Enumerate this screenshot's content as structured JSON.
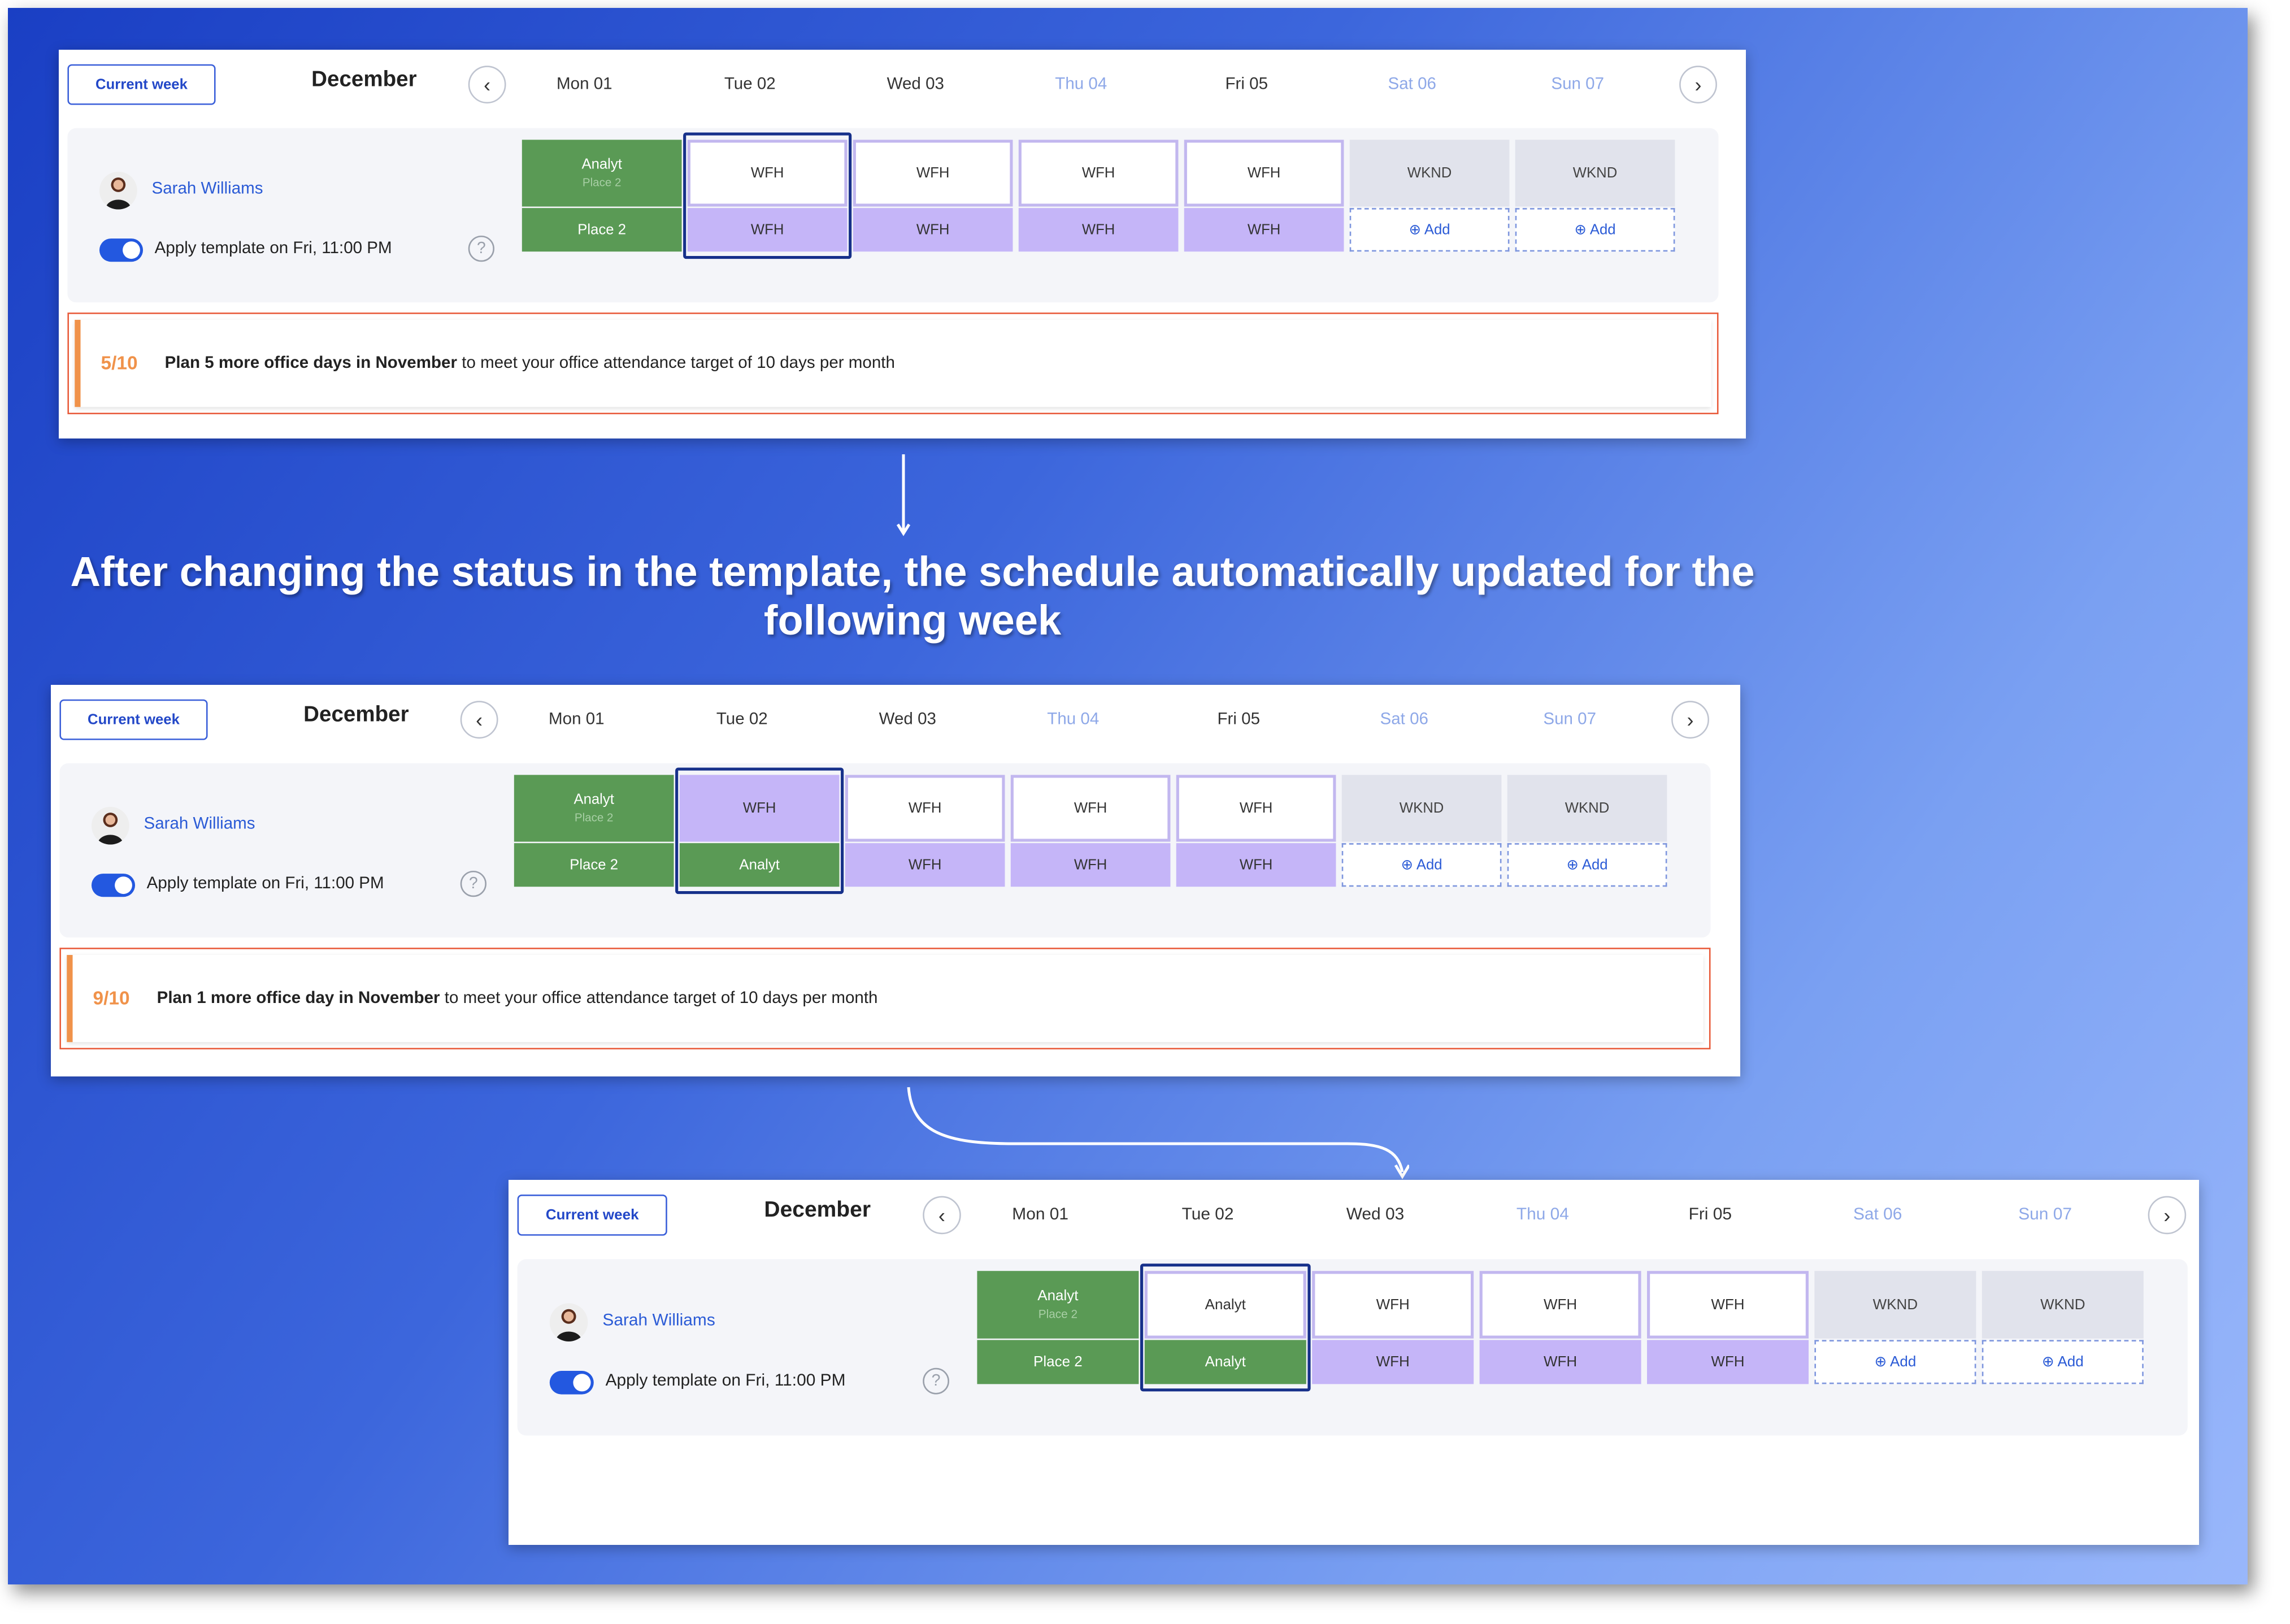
{
  "caption": "After changing the status in the template, the schedule automatically updated for the following week",
  "colors": {
    "office": "#5a9a55",
    "wfh": "#c5b5f8",
    "weekend": "#e1e3ec",
    "accent": "#2358e0",
    "alert_border": "#e85a3a",
    "alert_ratio": "#f0924a"
  },
  "panels": [
    {
      "toolbar": {
        "current_week": "Current week",
        "month": "December"
      },
      "days": [
        "Mon 01",
        "Tue 02",
        "Wed 03",
        "Thu 04",
        "Fri 05",
        "Sat 06",
        "Sun 07"
      ],
      "user": {
        "name": "Sarah Williams",
        "template_label": "Apply template on Fri, 11:00 PM",
        "help": "?"
      },
      "schedule_top": [
        {
          "label": "Analyt",
          "sub": "Place 2",
          "kind": "g"
        },
        {
          "label": "WFH",
          "sub": "",
          "kind": "w"
        },
        {
          "label": "WFH",
          "sub": "",
          "kind": "w"
        },
        {
          "label": "WFH",
          "sub": "",
          "kind": "w"
        },
        {
          "label": "WFH",
          "sub": "",
          "kind": "w"
        },
        {
          "label": "WKND",
          "sub": "",
          "kind": "k"
        },
        {
          "label": "WKND",
          "sub": "",
          "kind": "k"
        }
      ],
      "schedule_bottom": [
        {
          "label": "Place 2",
          "kind": "g"
        },
        {
          "label": "WFH",
          "kind": "p"
        },
        {
          "label": "WFH",
          "kind": "p"
        },
        {
          "label": "WFH",
          "kind": "p"
        },
        {
          "label": "WFH",
          "kind": "p"
        },
        {
          "label": "⊕ Add",
          "kind": "a"
        },
        {
          "label": "⊕ Add",
          "kind": "a"
        }
      ],
      "alert": {
        "ratio": "5/10",
        "bold": "Plan 5 more office days in November",
        "rest": " to meet your office attendance target of 10 days per month"
      }
    },
    {
      "toolbar": {
        "current_week": "Current week",
        "month": "December"
      },
      "days": [
        "Mon 01",
        "Tue 02",
        "Wed 03",
        "Thu 04",
        "Fri 05",
        "Sat 06",
        "Sun 07"
      ],
      "user": {
        "name": "Sarah Williams",
        "template_label": "Apply template on Fri, 11:00 PM",
        "help": "?"
      },
      "schedule_top": [
        {
          "label": "Analyt",
          "sub": "Place 2",
          "kind": "g"
        },
        {
          "label": "WFH",
          "sub": "",
          "kind": "p"
        },
        {
          "label": "WFH",
          "sub": "",
          "kind": "w"
        },
        {
          "label": "WFH",
          "sub": "",
          "kind": "w"
        },
        {
          "label": "WFH",
          "sub": "",
          "kind": "w"
        },
        {
          "label": "WKND",
          "sub": "",
          "kind": "k"
        },
        {
          "label": "WKND",
          "sub": "",
          "kind": "k"
        }
      ],
      "schedule_bottom": [
        {
          "label": "Place 2",
          "kind": "g"
        },
        {
          "label": "Analyt",
          "kind": "g"
        },
        {
          "label": "WFH",
          "kind": "p"
        },
        {
          "label": "WFH",
          "kind": "p"
        },
        {
          "label": "WFH",
          "kind": "p"
        },
        {
          "label": "⊕ Add",
          "kind": "a"
        },
        {
          "label": "⊕ Add",
          "kind": "a"
        }
      ],
      "alert": {
        "ratio": "9/10",
        "bold": "Plan 1 more office day in November",
        "rest": " to meet your office attendance target of 10 days per month"
      }
    },
    {
      "toolbar": {
        "current_week": "Current week",
        "month": "December"
      },
      "days": [
        "Mon 01",
        "Tue 02",
        "Wed 03",
        "Thu 04",
        "Fri 05",
        "Sat 06",
        "Sun 07"
      ],
      "user": {
        "name": "Sarah Williams",
        "template_label": "Apply template on Fri, 11:00 PM",
        "help": "?"
      },
      "schedule_top": [
        {
          "label": "Analyt",
          "sub": "Place 2",
          "kind": "g"
        },
        {
          "label": "Analyt",
          "sub": "",
          "kind": "w"
        },
        {
          "label": "WFH",
          "sub": "",
          "kind": "w"
        },
        {
          "label": "WFH",
          "sub": "",
          "kind": "w"
        },
        {
          "label": "WFH",
          "sub": "",
          "kind": "w"
        },
        {
          "label": "WKND",
          "sub": "",
          "kind": "k"
        },
        {
          "label": "WKND",
          "sub": "",
          "kind": "k"
        }
      ],
      "schedule_bottom": [
        {
          "label": "Place 2",
          "kind": "g"
        },
        {
          "label": "Analyt",
          "kind": "g"
        },
        {
          "label": "WFH",
          "kind": "p"
        },
        {
          "label": "WFH",
          "kind": "p"
        },
        {
          "label": "WFH",
          "kind": "p"
        },
        {
          "label": "⊕ Add",
          "kind": "a"
        },
        {
          "label": "⊕ Add",
          "kind": "a"
        }
      ],
      "alert": null
    }
  ]
}
